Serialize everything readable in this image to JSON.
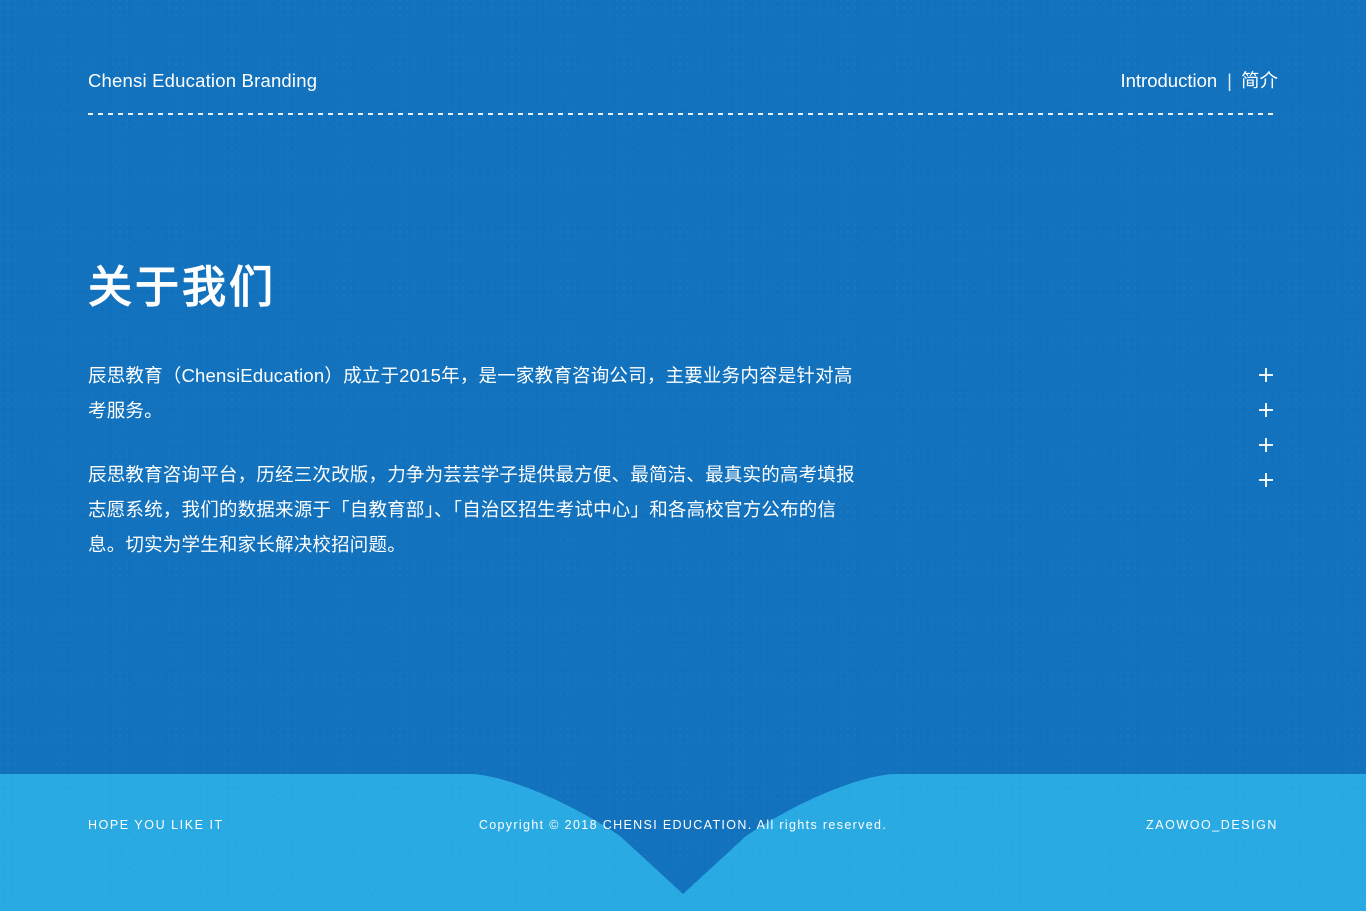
{
  "header": {
    "brand_title": "Chensi Education Branding",
    "section_en": "Introduction",
    "separator": "|",
    "section_zh": "简介"
  },
  "main": {
    "page_title": "关于我们",
    "paragraphs": [
      "辰思教育（ChensiEducation）成立于2015年，是一家教育咨询公司，主要业务内容是针对高考服务。",
      "辰思教育咨询平台，历经三次改版，力争为芸芸学子提供最方便、最简洁、最真实的高考填报志愿系统，我们的数据来源于「自教育部」、「自治区招生考试中心」和各高校官方公布的信息。切实为学生和家长解决校招问题。"
    ],
    "plus_marks": [
      "+",
      "+",
      "+",
      "+"
    ]
  },
  "footer": {
    "left_text": "HOPE YOU LIKE IT",
    "center_text": "Copyright © 2018 CHENSI EDUCATION. All rights reserved.",
    "right_text": "ZAOWOO_DESIGN"
  },
  "colors": {
    "background_blue": "#1272bd",
    "footer_cyan": "#29aae2",
    "footer_notch_blue": "#1272bd",
    "text_white": "#ffffff"
  }
}
